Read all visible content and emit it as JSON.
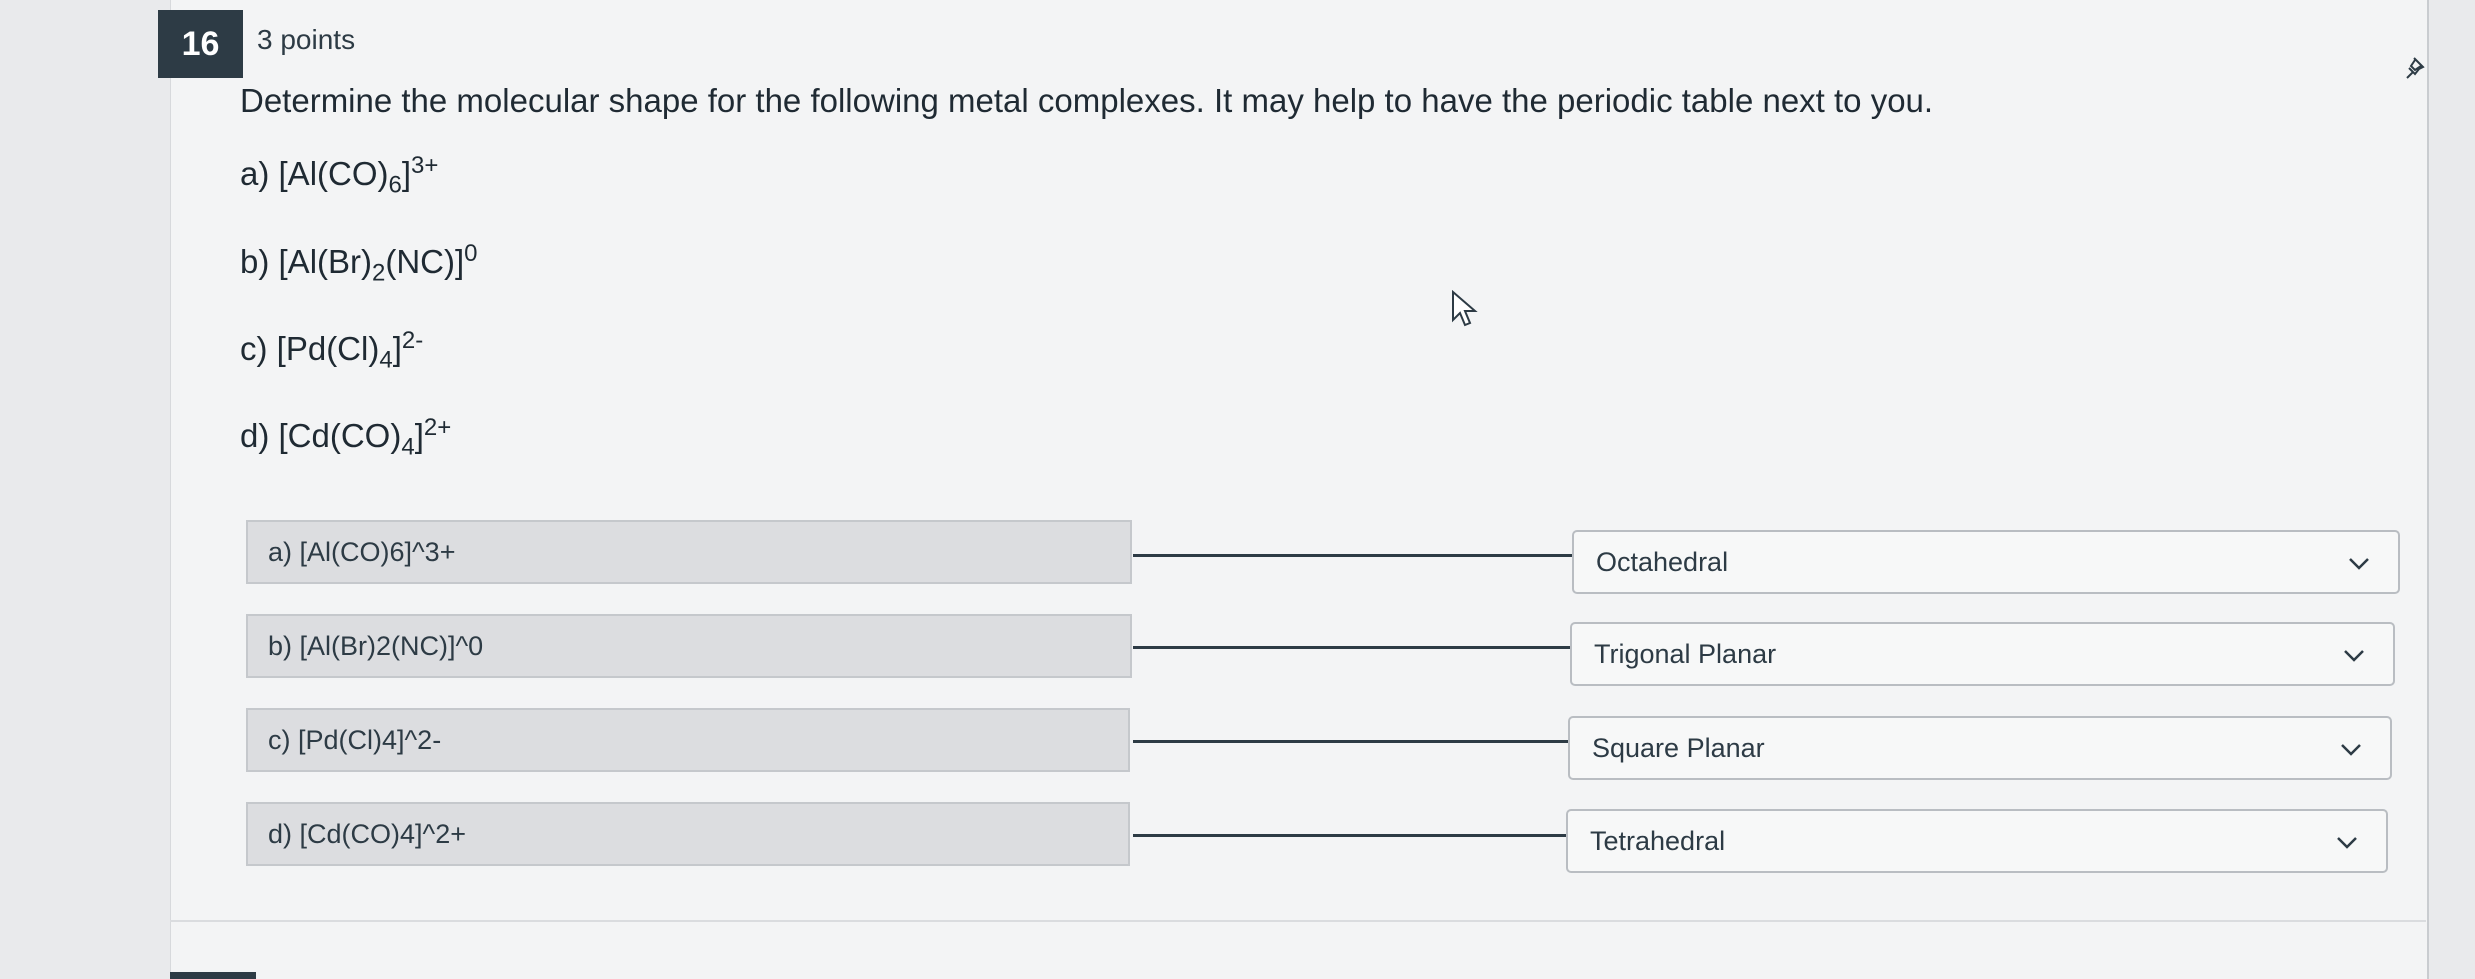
{
  "question": {
    "number": "16",
    "points": "3 points",
    "prompt": "Determine the molecular shape for the following metal complexes. It may help to have the periodic table next to you."
  },
  "formulas": [
    {
      "label": "a) [Al(CO)",
      "sub": "6",
      "mid": "]",
      "sup": "3+"
    },
    {
      "label": "b) [Al(Br)",
      "sub": "2",
      "mid": "(NC)]",
      "sup": "0"
    },
    {
      "label": "c) [Pd(Cl)",
      "sub": "4",
      "mid": "]",
      "sup": "2-"
    },
    {
      "label": "d) [Cd(CO)",
      "sub": "4",
      "mid": "]",
      "sup": "2+"
    }
  ],
  "matches": [
    {
      "prompt": "a) [Al(CO)6]^3+",
      "answer": "Octahedral"
    },
    {
      "prompt": "b) [Al(Br)2(NC)]^0",
      "answer": "Trigonal Planar"
    },
    {
      "prompt": "c) [Pd(Cl)4]^2-",
      "answer": "Square Planar"
    },
    {
      "prompt": "d) [Cd(CO)4]^2+",
      "answer": "Tetrahedral"
    }
  ],
  "icons": {
    "pin": "pin-icon",
    "cursor": "mouse-pointer-icon",
    "dropdown": "chevron-down-icon"
  },
  "colors": {
    "header_badge": "#2d3b45",
    "card_background": "#f3f4f5",
    "match_prompt_background": "#dcdde0",
    "select_background": "#f7f8f8"
  }
}
